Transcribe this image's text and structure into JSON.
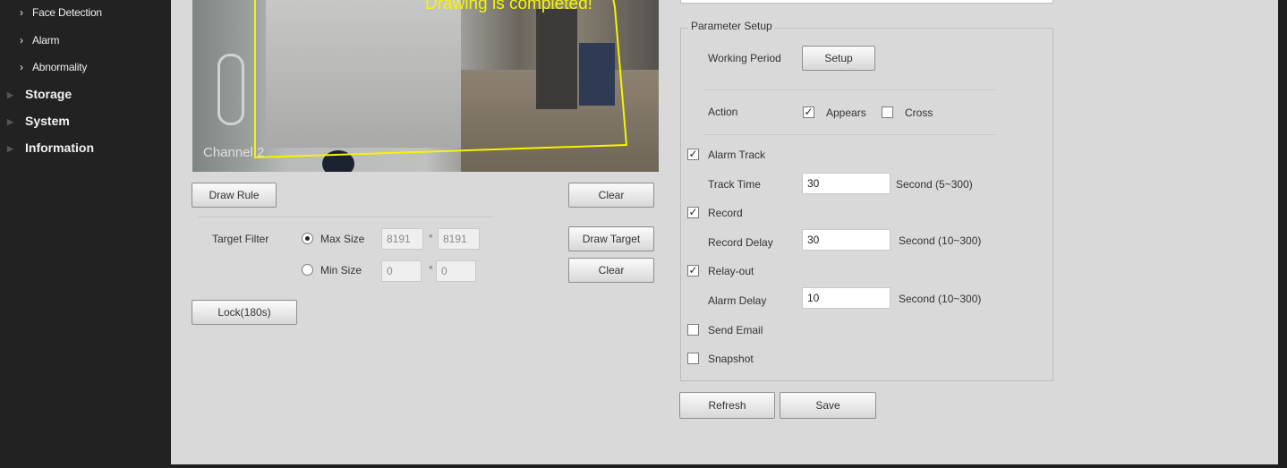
{
  "sidebar": {
    "sub_items": [
      {
        "label": "Face Detection"
      },
      {
        "label": "Alarm"
      },
      {
        "label": "Abnormality"
      }
    ],
    "top_items": [
      {
        "label": "Storage"
      },
      {
        "label": "System"
      },
      {
        "label": "Information"
      }
    ]
  },
  "video": {
    "status_message": "Drawing is completed!",
    "channel_label": "Channel 2"
  },
  "rule": {
    "draw_rule_label": "Draw Rule",
    "clear_label": "Clear",
    "target_filter_label": "Target Filter",
    "max_size_label": "Max Size",
    "max_w": "8191",
    "max_h": "8191",
    "min_size_label": "Min Size",
    "min_w": "0",
    "min_h": "0",
    "star": "*",
    "draw_target_label": "Draw Target",
    "clear_target_label": "Clear",
    "lock_label": "Lock(180s)",
    "max_selected": true
  },
  "params": {
    "legend": "Parameter Setup",
    "working_period_label": "Working Period",
    "setup_label": "Setup",
    "action_label": "Action",
    "appears_label": "Appears",
    "appears_checked": true,
    "cross_label": "Cross",
    "cross_checked": false,
    "alarm_track_label": "Alarm Track",
    "alarm_track_checked": true,
    "track_time_label": "Track Time",
    "track_time_value": "30",
    "track_time_unit": "Second (5~300)",
    "record_label": "Record",
    "record_checked": true,
    "record_delay_label": "Record Delay",
    "record_delay_value": "30",
    "record_delay_unit": "Second (10~300)",
    "relay_label": "Relay-out",
    "relay_checked": true,
    "alarm_delay_label": "Alarm Delay",
    "alarm_delay_value": "10",
    "alarm_delay_unit": "Second (10~300)",
    "send_email_label": "Send Email",
    "send_email_checked": false,
    "snapshot_label": "Snapshot",
    "snapshot_checked": false
  },
  "footer": {
    "refresh_label": "Refresh",
    "save_label": "Save"
  },
  "colors": {
    "sidebar_bg": "#222222",
    "panel_bg": "#d9d9d9",
    "roi_line": "#f5f500"
  }
}
